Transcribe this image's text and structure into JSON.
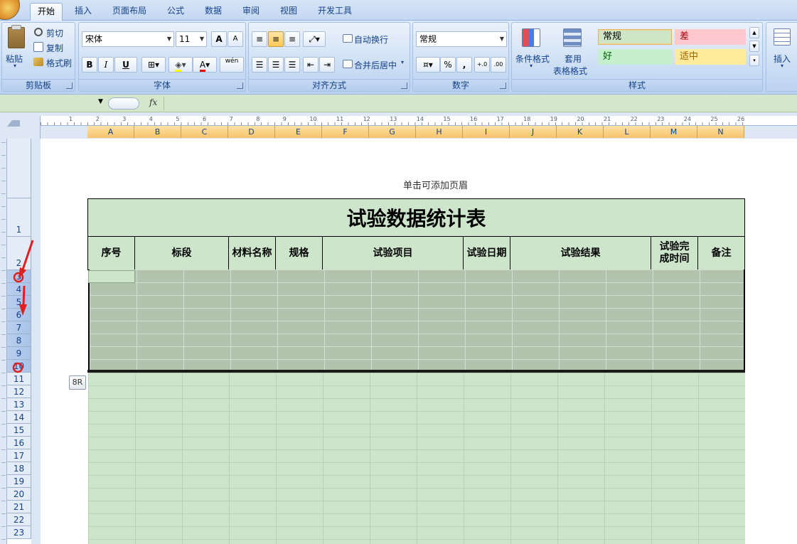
{
  "tabs": [
    "开始",
    "插入",
    "页面布局",
    "公式",
    "数据",
    "审阅",
    "视图",
    "开发工具"
  ],
  "ribbon": {
    "clipboard": {
      "paste": "粘贴",
      "cut": "剪切",
      "copy": "复制",
      "format_painter": "格式刷",
      "label": "剪贴板"
    },
    "font": {
      "name": "宋体",
      "size": "11",
      "bold": "B",
      "italic": "I",
      "underline": "U",
      "grow": "A",
      "shrink": "A",
      "phonetic": "wén",
      "label": "字体"
    },
    "alignment": {
      "wrap": "自动换行",
      "merge": "合并后居中",
      "label": "对齐方式"
    },
    "number": {
      "format": "常规",
      "percent": "%",
      "comma": ",",
      "inc_decimal": "+.0",
      "dec_decimal": ".00",
      "label": "数字"
    },
    "styles": {
      "conditional": "条件格式",
      "table1": "套用",
      "table2": "表格格式",
      "normal": "常规",
      "bad": "差",
      "good": "好",
      "neutral": "适中",
      "label": "样式"
    },
    "cells": {
      "insert": "插入"
    }
  },
  "formula": {
    "fx": "fx"
  },
  "columns": [
    "A",
    "B",
    "C",
    "D",
    "E",
    "F",
    "G",
    "H",
    "I",
    "J",
    "K",
    "L",
    "M",
    "N"
  ],
  "ruler": [
    "1",
    "2",
    "3",
    "4",
    "5",
    "6",
    "7",
    "8",
    "9",
    "10",
    "11",
    "12",
    "13",
    "14",
    "15",
    "16",
    "17",
    "18",
    "19",
    "20",
    "21",
    "22",
    "23",
    "24",
    "25",
    "26"
  ],
  "rows": [
    "1",
    "2",
    "3",
    "4",
    "5",
    "6",
    "7",
    "8",
    "9",
    "10",
    "11",
    "12",
    "13",
    "14",
    "15",
    "16",
    "17",
    "18",
    "19",
    "20",
    "21",
    "22",
    "23"
  ],
  "header_placeholder": "单击可添加页眉",
  "table": {
    "title": "试验数据统计表",
    "headers": [
      "序号",
      "标段",
      "材料名称",
      "规格",
      "试验项目",
      "试验日期",
      "试验结果",
      "试验完\n成时间",
      "备注"
    ]
  },
  "tooltip": "8R",
  "colors": {
    "accent": "#15428b",
    "cell_green": "#cde6cb",
    "selection": "#b2c3ad"
  }
}
